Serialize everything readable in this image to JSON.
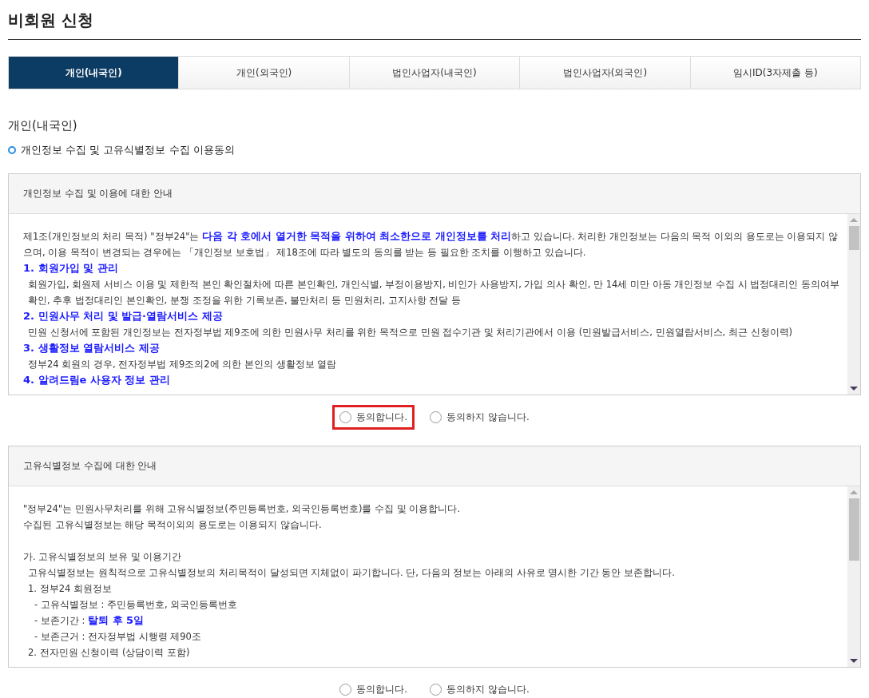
{
  "page_title": "비회원 신청",
  "tabs": [
    {
      "label": "개인(내국인)",
      "selected": true
    },
    {
      "label": "개인(외국인)",
      "selected": false
    },
    {
      "label": "법인사업자(내국인)",
      "selected": false
    },
    {
      "label": "법인사업자(외국인)",
      "selected": false
    },
    {
      "label": "임시ID(3자제출 등)",
      "selected": false
    }
  ],
  "section_title": "개인(내국인)",
  "consent_heading": "개인정보 수집 및 고유식별정보 수집 이용동의",
  "panels": [
    {
      "title": "개인정보 수집 및 이용에 대한 안내",
      "lines": [
        {
          "kind": "text",
          "text": "제1조(개인정보의 처리 목적) \"정부24\"는 **다음 각 호에서 열거한 목적을 위하여 최소한으로 개인정보를 처리**하고 있습니다. 처리한 개인정보는 다음의 목적 이외의 용도로는 이용되지 않으며, 이용 목적이 변경되는 경우에는 「개인정보 보호법」 제18조에 따라 별도의 동의를 받는 등 필요한 조치를 이행하고 있습니다."
        },
        {
          "kind": "heading",
          "text": "1. 회원가입 및 관리"
        },
        {
          "kind": "indent",
          "text": "회원가입, 회원제 서비스 이용 및 제한적 본인 확인절차에 따른 본인확인, 개인식별, 부정이용방지, 비인가 사용방지, 가입 의사 확인, 만 14세 미만 아동 개인정보 수집 시 법정대리인 동의여부 확인, 추후 법정대리인 본인확인, 분쟁 조정을 위한 기록보존, 불만처리 등 민원처리, 고지사항 전달 등"
        },
        {
          "kind": "heading",
          "text": "2. 민원사무 처리 및 발급·열람서비스 제공"
        },
        {
          "kind": "indent",
          "text": "민원 신청서에 포함된 개인정보는 전자정부법 제9조에 의한 민원사무 처리를 위한 목적으로 민원 접수기관 및 처리기관에서 이용 (민원발급서비스, 민원열람서비스, 최근 신청이력)"
        },
        {
          "kind": "heading",
          "text": "3. 생활정보 열람서비스 제공"
        },
        {
          "kind": "indent",
          "text": "정부24 회원의 경우, 전자정부법 제9조의2에 의한 본인의 생활정보 열람"
        },
        {
          "kind": "heading",
          "text": "4. 알려드림e 사용자 정보 관리"
        }
      ],
      "options": [
        {
          "label": "동의합니다.",
          "selected": false,
          "highlighted": true
        },
        {
          "label": "동의하지 않습니다.",
          "selected": false,
          "highlighted": false
        }
      ]
    },
    {
      "title": "고유식별정보 수집에 대한 안내",
      "lines": [
        {
          "kind": "text",
          "text": "\"정부24\"는 민원사무처리를 위해 고유식별정보(주민등록번호, 외국인등록번호)를 수집 및 이용합니다."
        },
        {
          "kind": "text",
          "text": "수집된 고유식별정보는 해당 목적이외의 용도로는 이용되지 않습니다."
        },
        {
          "kind": "blank"
        },
        {
          "kind": "text",
          "text": "가. 고유식별정보의 보유 및 이용기간"
        },
        {
          "kind": "indent",
          "text": "고유식별정보는 원칙적으로 고유식별정보의 처리목적이 달성되면 지체없이 파기합니다. 단, 다음의 정보는 아래의 사유로 명시한 기간 동안 보존합니다."
        },
        {
          "kind": "indent",
          "text": "1. 정부24 회원정보"
        },
        {
          "kind": "sub",
          "text": "- 고유식별정보 : 주민등록번호, 외국인등록번호"
        },
        {
          "kind": "sub",
          "text": "- 보존기간 : **탈퇴 후 5일**"
        },
        {
          "kind": "sub",
          "text": "- 보존근거 : 전자정부법 시행령 제90조"
        },
        {
          "kind": "indent",
          "text": "2. 전자민원 신청이력 (상담이력 포함)"
        }
      ],
      "options": [
        {
          "label": "동의합니다.",
          "selected": false,
          "highlighted": false
        },
        {
          "label": "동의하지 않습니다.",
          "selected": false,
          "highlighted": false
        }
      ]
    }
  ]
}
